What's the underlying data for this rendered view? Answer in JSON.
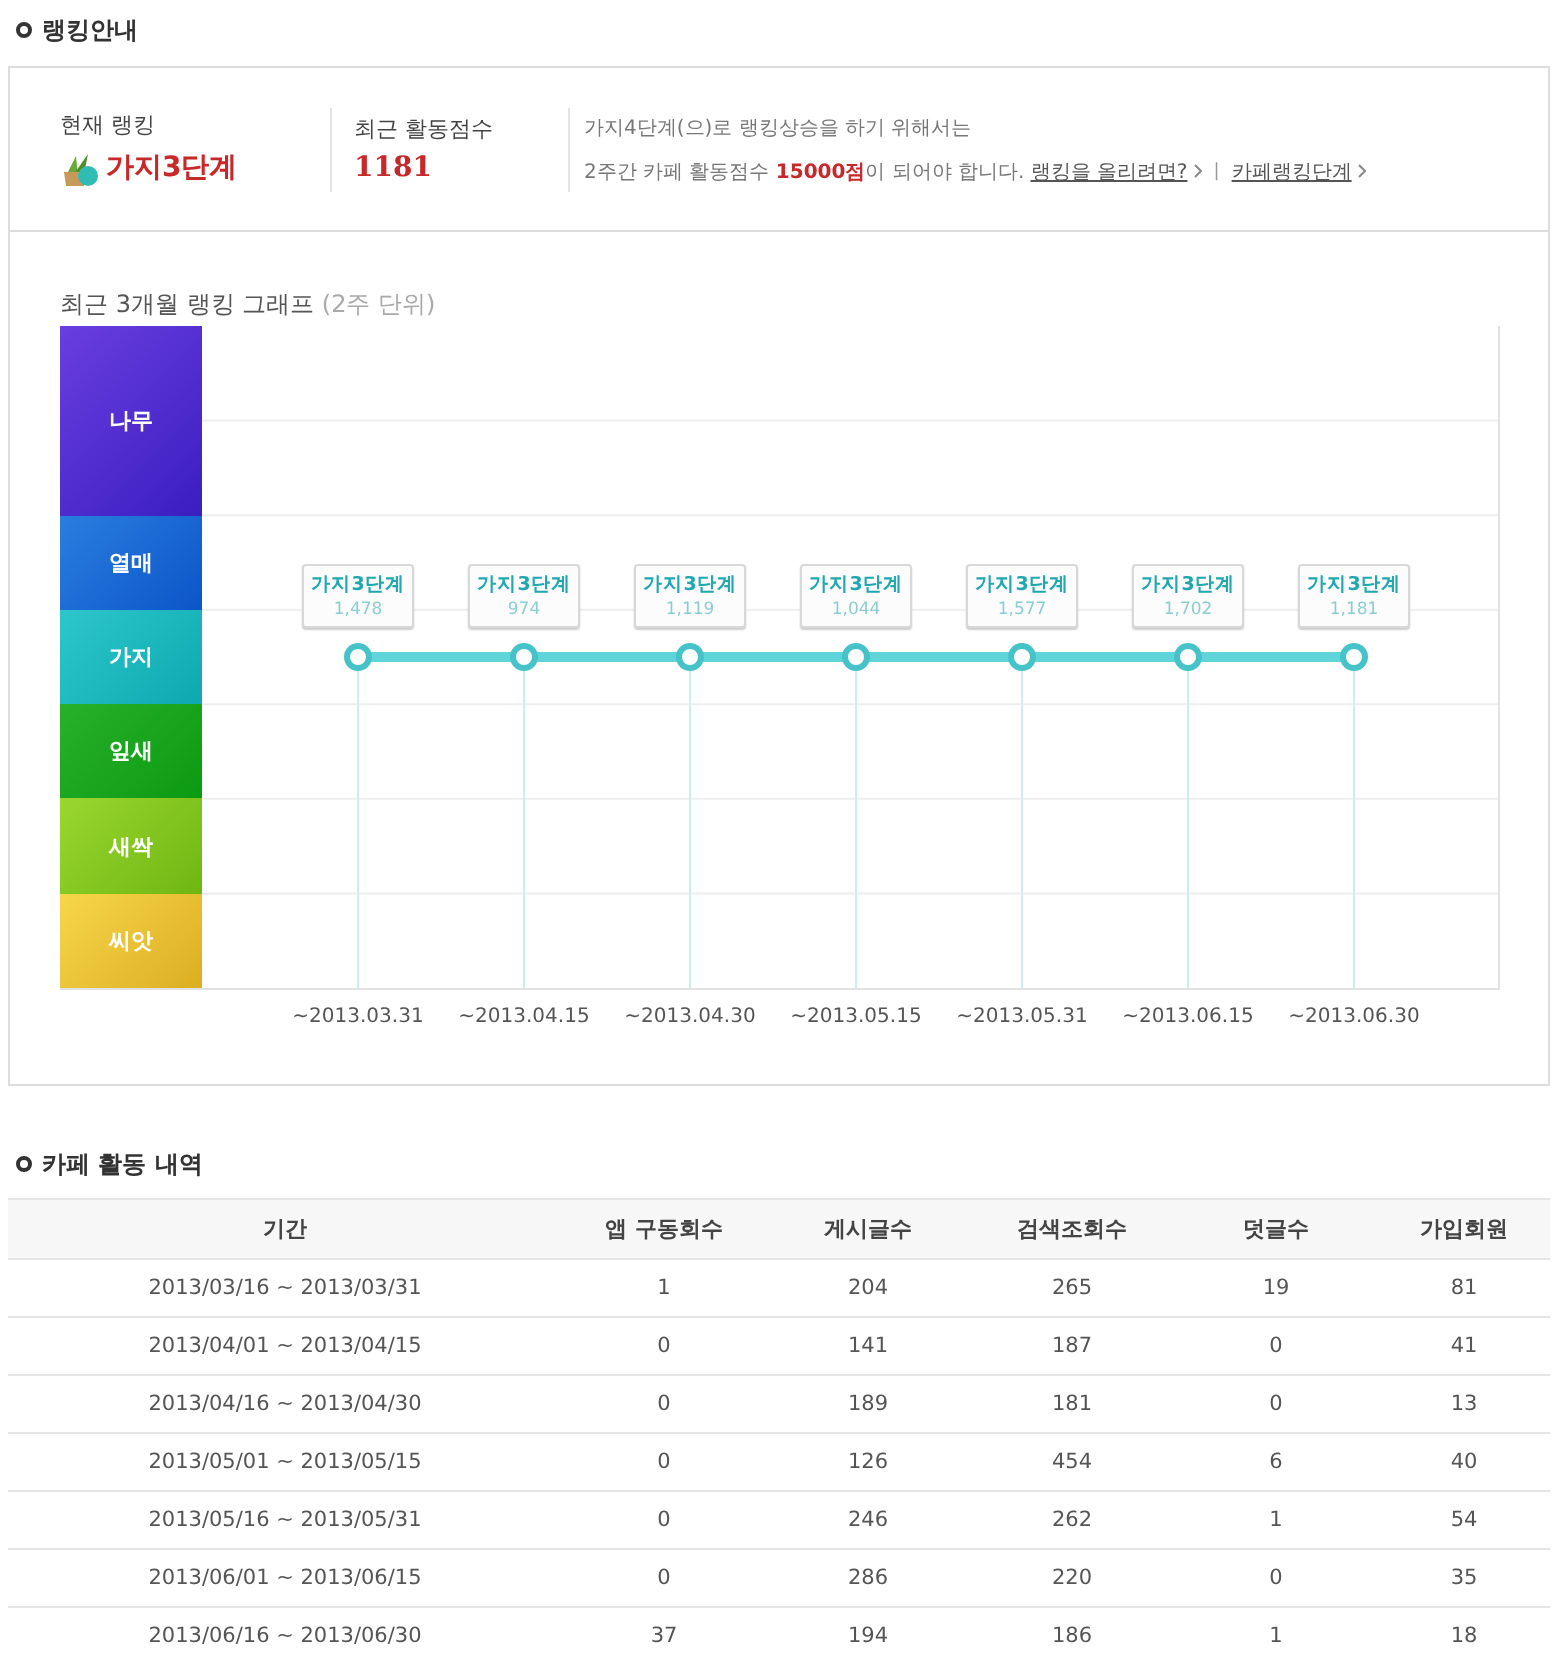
{
  "ranking_section": {
    "heading": "랭킹안내",
    "current_rank": {
      "label": "현재 랭킹",
      "value": "가지3단계"
    },
    "recent_score": {
      "label": "최근 활동점수",
      "value": "1181"
    },
    "guide": {
      "line1": "가지4단계(으)로 랭킹상승을 하기 위해서는",
      "line2": "2주간 카페 활동점수 **15000점**이 되어야 합니다.",
      "link1": "랭킹을 올리려면?",
      "separator": "|",
      "link2": "카페랭킹단계"
    },
    "chart_title": "최근 3개월 랭킹 그래프",
    "chart_subtitle": "(2주 단위)",
    "rank_graph": {
      "dates": [
        "~2013.03.31",
        "~2013.04.15",
        "~2013.04.30",
        "~2013.05.15",
        "~2013.05.31",
        "~2013.06.15",
        "~2013.06.30"
      ],
      "bands": [
        {
          "label": "나무"
        },
        {
          "label": "열매"
        },
        {
          "label": "가지",
          "points": [
            {
              "rank": "가지3단계",
              "score": "1,478"
            },
            {
              "rank": "가지3단계",
              "score": "974"
            },
            {
              "rank": "가지3단계",
              "score": "1,119"
            },
            {
              "rank": "가지3단계",
              "score": "1,044"
            },
            {
              "rank": "가지3단계",
              "score": "1,577"
            },
            {
              "rank": "가지3단계",
              "score": "1,702"
            },
            {
              "rank": "가지3단계",
              "score": "1,181"
            }
          ]
        },
        {
          "label": "잎새"
        },
        {
          "label": "새싹"
        },
        {
          "label": "씨앗"
        }
      ]
    }
  },
  "activity_section": {
    "heading": "카페 활동 내역",
    "columns": [
      "기간",
      "앱 구동회수",
      "게시글수",
      "검색조회수",
      "덧글수",
      "가입회원"
    ],
    "rows": [
      [
        "2013/03/16 ~ 2013/03/31",
        "1",
        "204",
        "265",
        "19",
        "81"
      ],
      [
        "2013/04/01 ~ 2013/04/15",
        "0",
        "141",
        "187",
        "0",
        "41"
      ],
      [
        "2013/04/16 ~ 2013/04/30",
        "0",
        "189",
        "181",
        "0",
        "13"
      ],
      [
        "2013/05/01 ~ 2013/05/15",
        "0",
        "126",
        "454",
        "6",
        "40"
      ],
      [
        "2013/05/16 ~ 2013/05/31",
        "0",
        "246",
        "262",
        "1",
        "54"
      ],
      [
        "2013/06/01 ~ 2013/06/15",
        "0",
        "286",
        "220",
        "0",
        "35"
      ],
      [
        "2013/06/16 ~ 2013/06/30",
        "37",
        "194",
        "186",
        "1",
        "18"
      ]
    ]
  }
}
